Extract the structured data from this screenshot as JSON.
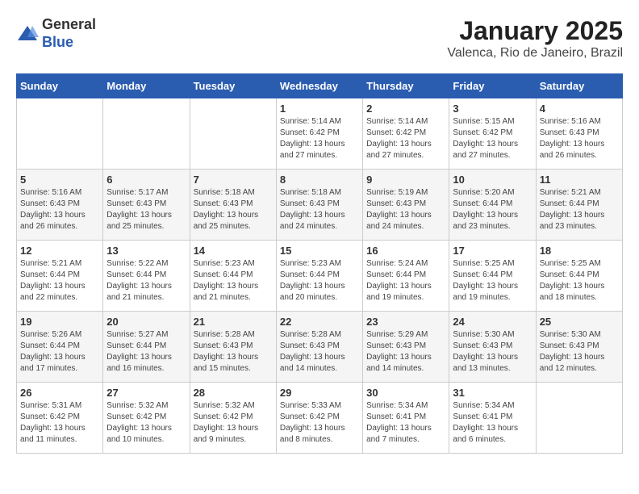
{
  "header": {
    "logo_line1": "General",
    "logo_line2": "Blue",
    "title": "January 2025",
    "subtitle": "Valenca, Rio de Janeiro, Brazil"
  },
  "weekdays": [
    "Sunday",
    "Monday",
    "Tuesday",
    "Wednesday",
    "Thursday",
    "Friday",
    "Saturday"
  ],
  "weeks": [
    [
      {
        "day": "",
        "info": ""
      },
      {
        "day": "",
        "info": ""
      },
      {
        "day": "",
        "info": ""
      },
      {
        "day": "1",
        "info": "Sunrise: 5:14 AM\nSunset: 6:42 PM\nDaylight: 13 hours\nand 27 minutes."
      },
      {
        "day": "2",
        "info": "Sunrise: 5:14 AM\nSunset: 6:42 PM\nDaylight: 13 hours\nand 27 minutes."
      },
      {
        "day": "3",
        "info": "Sunrise: 5:15 AM\nSunset: 6:42 PM\nDaylight: 13 hours\nand 27 minutes."
      },
      {
        "day": "4",
        "info": "Sunrise: 5:16 AM\nSunset: 6:43 PM\nDaylight: 13 hours\nand 26 minutes."
      }
    ],
    [
      {
        "day": "5",
        "info": "Sunrise: 5:16 AM\nSunset: 6:43 PM\nDaylight: 13 hours\nand 26 minutes."
      },
      {
        "day": "6",
        "info": "Sunrise: 5:17 AM\nSunset: 6:43 PM\nDaylight: 13 hours\nand 25 minutes."
      },
      {
        "day": "7",
        "info": "Sunrise: 5:18 AM\nSunset: 6:43 PM\nDaylight: 13 hours\nand 25 minutes."
      },
      {
        "day": "8",
        "info": "Sunrise: 5:18 AM\nSunset: 6:43 PM\nDaylight: 13 hours\nand 24 minutes."
      },
      {
        "day": "9",
        "info": "Sunrise: 5:19 AM\nSunset: 6:43 PM\nDaylight: 13 hours\nand 24 minutes."
      },
      {
        "day": "10",
        "info": "Sunrise: 5:20 AM\nSunset: 6:44 PM\nDaylight: 13 hours\nand 23 minutes."
      },
      {
        "day": "11",
        "info": "Sunrise: 5:21 AM\nSunset: 6:44 PM\nDaylight: 13 hours\nand 23 minutes."
      }
    ],
    [
      {
        "day": "12",
        "info": "Sunrise: 5:21 AM\nSunset: 6:44 PM\nDaylight: 13 hours\nand 22 minutes."
      },
      {
        "day": "13",
        "info": "Sunrise: 5:22 AM\nSunset: 6:44 PM\nDaylight: 13 hours\nand 21 minutes."
      },
      {
        "day": "14",
        "info": "Sunrise: 5:23 AM\nSunset: 6:44 PM\nDaylight: 13 hours\nand 21 minutes."
      },
      {
        "day": "15",
        "info": "Sunrise: 5:23 AM\nSunset: 6:44 PM\nDaylight: 13 hours\nand 20 minutes."
      },
      {
        "day": "16",
        "info": "Sunrise: 5:24 AM\nSunset: 6:44 PM\nDaylight: 13 hours\nand 19 minutes."
      },
      {
        "day": "17",
        "info": "Sunrise: 5:25 AM\nSunset: 6:44 PM\nDaylight: 13 hours\nand 19 minutes."
      },
      {
        "day": "18",
        "info": "Sunrise: 5:25 AM\nSunset: 6:44 PM\nDaylight: 13 hours\nand 18 minutes."
      }
    ],
    [
      {
        "day": "19",
        "info": "Sunrise: 5:26 AM\nSunset: 6:44 PM\nDaylight: 13 hours\nand 17 minutes."
      },
      {
        "day": "20",
        "info": "Sunrise: 5:27 AM\nSunset: 6:44 PM\nDaylight: 13 hours\nand 16 minutes."
      },
      {
        "day": "21",
        "info": "Sunrise: 5:28 AM\nSunset: 6:43 PM\nDaylight: 13 hours\nand 15 minutes."
      },
      {
        "day": "22",
        "info": "Sunrise: 5:28 AM\nSunset: 6:43 PM\nDaylight: 13 hours\nand 14 minutes."
      },
      {
        "day": "23",
        "info": "Sunrise: 5:29 AM\nSunset: 6:43 PM\nDaylight: 13 hours\nand 14 minutes."
      },
      {
        "day": "24",
        "info": "Sunrise: 5:30 AM\nSunset: 6:43 PM\nDaylight: 13 hours\nand 13 minutes."
      },
      {
        "day": "25",
        "info": "Sunrise: 5:30 AM\nSunset: 6:43 PM\nDaylight: 13 hours\nand 12 minutes."
      }
    ],
    [
      {
        "day": "26",
        "info": "Sunrise: 5:31 AM\nSunset: 6:42 PM\nDaylight: 13 hours\nand 11 minutes."
      },
      {
        "day": "27",
        "info": "Sunrise: 5:32 AM\nSunset: 6:42 PM\nDaylight: 13 hours\nand 10 minutes."
      },
      {
        "day": "28",
        "info": "Sunrise: 5:32 AM\nSunset: 6:42 PM\nDaylight: 13 hours\nand 9 minutes."
      },
      {
        "day": "29",
        "info": "Sunrise: 5:33 AM\nSunset: 6:42 PM\nDaylight: 13 hours\nand 8 minutes."
      },
      {
        "day": "30",
        "info": "Sunrise: 5:34 AM\nSunset: 6:41 PM\nDaylight: 13 hours\nand 7 minutes."
      },
      {
        "day": "31",
        "info": "Sunrise: 5:34 AM\nSunset: 6:41 PM\nDaylight: 13 hours\nand 6 minutes."
      },
      {
        "day": "",
        "info": ""
      }
    ]
  ]
}
